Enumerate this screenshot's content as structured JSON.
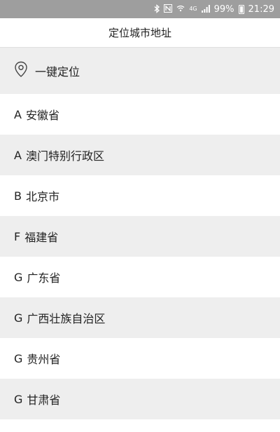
{
  "status_bar": {
    "icons": [
      "bluetooth-icon",
      "nfc-icon",
      "wifi-icon",
      "4g-icon",
      "signal-icon"
    ],
    "network": "4G",
    "battery": "99%",
    "time": "21:29"
  },
  "header": {
    "title": "定位城市地址"
  },
  "locate": {
    "label": "一键定位",
    "icon": "location-pin-icon"
  },
  "provinces": [
    {
      "letter": "A",
      "name": "安徽省"
    },
    {
      "letter": "A",
      "name": "澳门特别行政区"
    },
    {
      "letter": "B",
      "name": "北京市"
    },
    {
      "letter": "F",
      "name": "福建省"
    },
    {
      "letter": "G",
      "name": "广东省"
    },
    {
      "letter": "G",
      "name": "广西壮族自治区"
    },
    {
      "letter": "G",
      "name": "贵州省"
    },
    {
      "letter": "G",
      "name": "甘肃省"
    }
  ],
  "colors": {
    "status_bar": "#9e9e9e",
    "row_shaded": "#eeeeee",
    "row_white": "#ffffff"
  }
}
